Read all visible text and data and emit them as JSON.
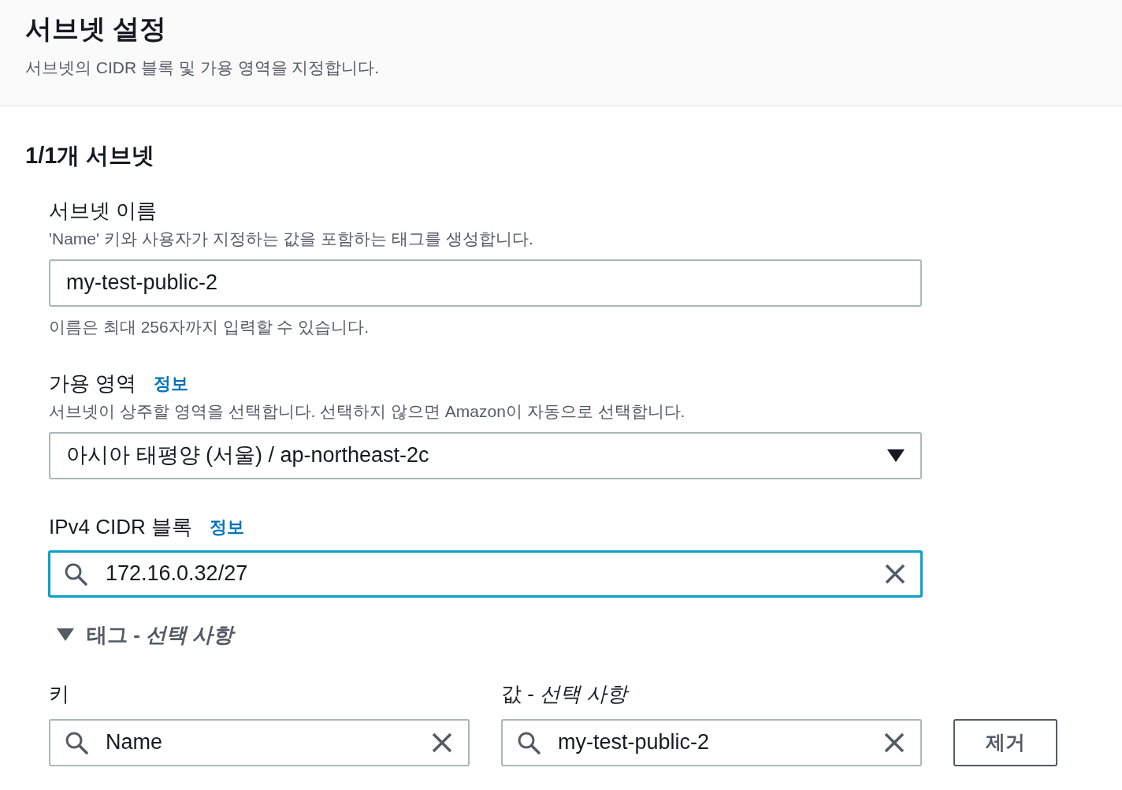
{
  "header": {
    "title": "서브넷 설정",
    "description": "서브넷의 CIDR 블록 및 가용 영역을 지정합니다."
  },
  "subnet": {
    "heading": "1/1개 서브넷",
    "name_field": {
      "label": "서브넷 이름",
      "description": "'Name' 키와 사용자가 지정하는 값을 포함하는 태그를 생성합니다.",
      "value": "my-test-public-2",
      "hint": "이름은 최대 256자까지 입력할 수 있습니다."
    },
    "availability_zone": {
      "label": "가용 영역",
      "info_link": "정보",
      "description": "서브넷이 상주할 영역을 선택합니다. 선택하지 않으면 Amazon이 자동으로 선택합니다.",
      "value": "아시아 태평양 (서울) / ap-northeast-2c"
    },
    "cidr": {
      "label": "IPv4 CIDR 블록",
      "info_link": "정보",
      "value": "172.16.0.32/27",
      "focused": true
    },
    "tags": {
      "title": "태그 - *선택 사항*",
      "expanded": true,
      "key_label": "키",
      "value_label": "값 - *선택 사항*",
      "rows": [
        {
          "key": "Name",
          "value": "my-test-public-2",
          "remove": "제거"
        }
      ]
    }
  }
}
